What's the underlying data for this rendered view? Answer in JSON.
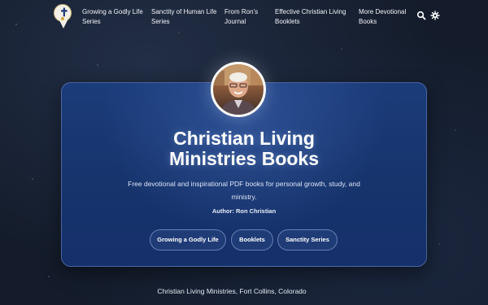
{
  "nav": {
    "items": [
      {
        "label_line1": "Growing a Godly Life",
        "label_line2": "Series"
      },
      {
        "label_line1": "Sanctity of Human Life",
        "label_line2": "Series"
      },
      {
        "label_line1": "From Ron's",
        "label_line2": "Journal"
      },
      {
        "label_line1": "Effective Christian Living",
        "label_line2": "Booklets"
      },
      {
        "label_line1": "More Devotional",
        "label_line2": "Books"
      }
    ],
    "icons": {
      "search": "search-icon",
      "settings": "gear-icon"
    }
  },
  "hero": {
    "title_line1": "Christian Living",
    "title_line2": "Ministries Books",
    "subtitle_line1": "Free devotional and inspirational PDF books for personal growth, study, and",
    "subtitle_line2": "ministry.",
    "author": "Author: Ron Christian",
    "buttons": [
      {
        "label": "Growing a Godly Life"
      },
      {
        "label": "Booklets"
      },
      {
        "label": "Sanctity Series"
      }
    ]
  },
  "footer": {
    "text": "Christian Living Ministries, Fort Collins, Colorado"
  },
  "colors": {
    "background": "#141c2b",
    "card": "#17346d",
    "accent": "#d4a93a"
  }
}
